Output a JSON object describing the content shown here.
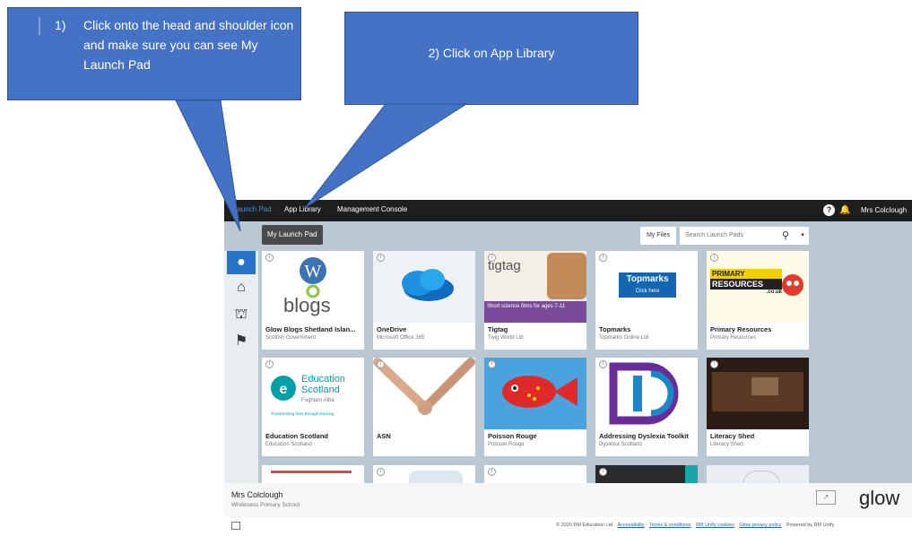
{
  "callouts": {
    "step1_num": "1)",
    "step1_text": "Click onto the head and shoulder icon and make sure you can see My Launch Pad",
    "step2_text": "2) Click on App Library"
  },
  "topbar": {
    "nav": [
      "Launch Pad",
      "App Library",
      "Management Console"
    ],
    "user": "Mrs Colclough"
  },
  "toolbar": {
    "tab_label": "My Launch Pad",
    "my_files": "My Files",
    "search_placeholder": "Search Launch Pads"
  },
  "tiles": [
    {
      "title": "Glow Blogs Shetland Islan...",
      "subtitle": "Scottish Government"
    },
    {
      "title": "OneDrive",
      "subtitle": "Microsoft Office 365"
    },
    {
      "title": "Tigtag",
      "subtitle": "Twig World Ltd"
    },
    {
      "title": "Topmarks",
      "subtitle": "Topmarks Online Ltd"
    },
    {
      "title": "Primary Resources",
      "subtitle": "Primary Resources"
    },
    {
      "title": "Education Scotland",
      "subtitle": "Education Scotland"
    },
    {
      "title": "ASN",
      "subtitle": ""
    },
    {
      "title": "Poisson Rouge",
      "subtitle": "Poisson Rouge"
    },
    {
      "title": "Addressing Dyslexia Toolkit",
      "subtitle": "Dyslexia Scotland"
    },
    {
      "title": "Literacy Shed",
      "subtitle": "Literacy Shed"
    }
  ],
  "tile_art": {
    "blogs": "blogs",
    "tigtag": "tigtag",
    "tigtag_banner": "Short science films for ages 7-11",
    "topmarks": "Topmarks",
    "topmarks_btn": "Click here",
    "primres_line1": "PRIMARY",
    "primres_line2": "RESOURCES",
    "primres_line3": ".co.uk",
    "edscot_1": "Education",
    "edscot_2": "Scotland",
    "edscot_3": "Foghlam Alba",
    "edscot_4": "Transforming lives through learning"
  },
  "footer": {
    "name": "Mrs Colclough",
    "school": "Whiteness Primary School",
    "logo": "glow",
    "copyright": "© 2020 RM Education Ltd",
    "links": [
      "Accessibility",
      "Terms & conditions",
      "RM Unify cookies",
      "Glow privacy policy"
    ],
    "powered": "Powered by RM Unify"
  },
  "colors": {
    "callout": "#4472c4",
    "topbar": "#1e1e1e",
    "content_bg": "#b9c8d2",
    "accent": "#2874c8"
  }
}
